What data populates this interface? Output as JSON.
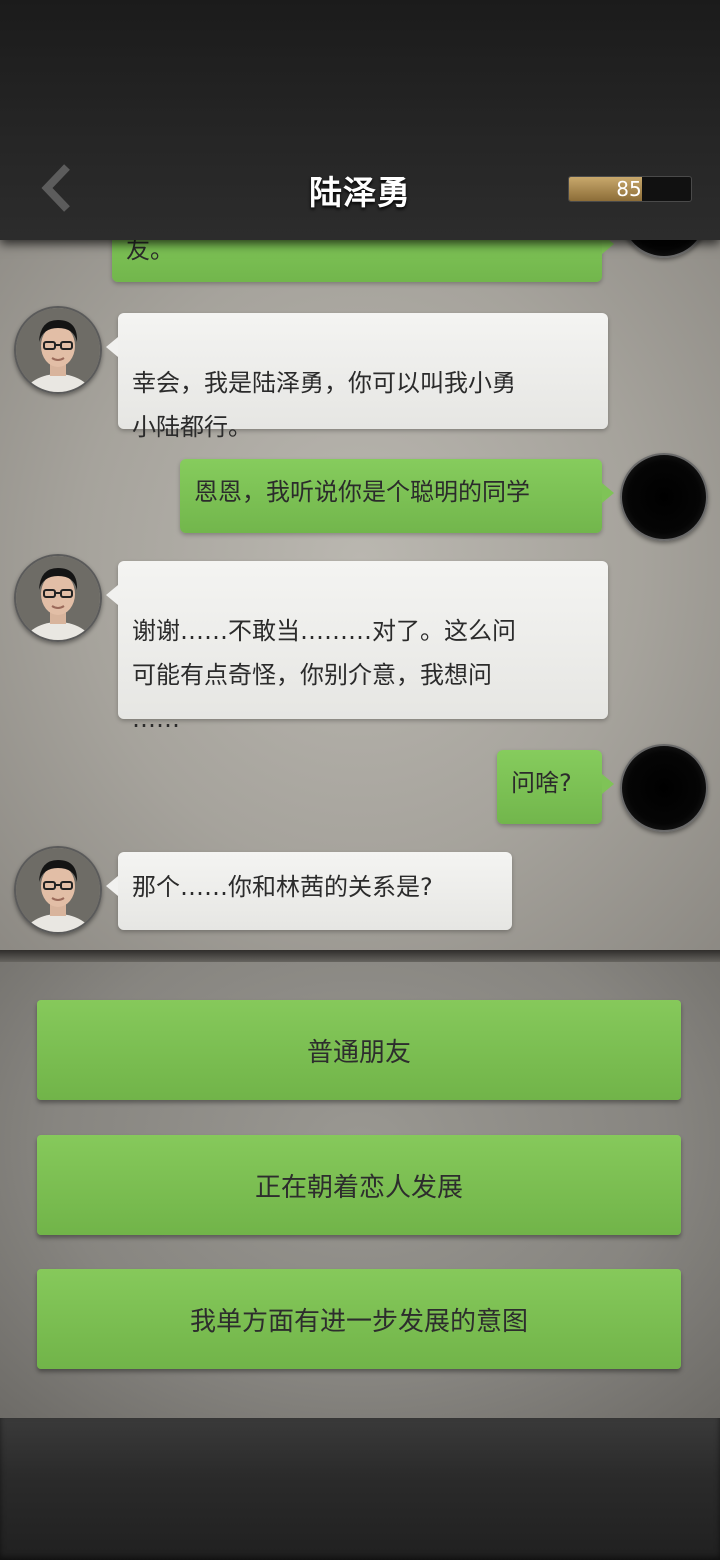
{
  "header": {
    "title": "陆泽勇",
    "meter_value": "85",
    "meter_fraction": 0.6
  },
  "messages": [
    {
      "side": "right",
      "text": "友。",
      "partial": true
    },
    {
      "side": "left",
      "text": "幸会，我是陆泽勇，你可以叫我小勇\n小陆都行。"
    },
    {
      "side": "right",
      "text": "恩恩，我听说你是个聪明的同学"
    },
    {
      "side": "left",
      "text": "谢谢……不敢当………对了。这么问\n可能有点奇怪，你别介意，我想问\n……"
    },
    {
      "side": "right",
      "text": "问啥?"
    },
    {
      "side": "left",
      "text": "那个……你和林茜的关系是?"
    }
  ],
  "options": [
    {
      "label": "普通朋友"
    },
    {
      "label": "正在朝着恋人发展"
    },
    {
      "label": "我单方面有进一步发展的意图"
    }
  ],
  "colors": {
    "bubble_green": "#7fc357",
    "bubble_white": "#f1f1ef",
    "meter_gold": "#b8965a"
  }
}
